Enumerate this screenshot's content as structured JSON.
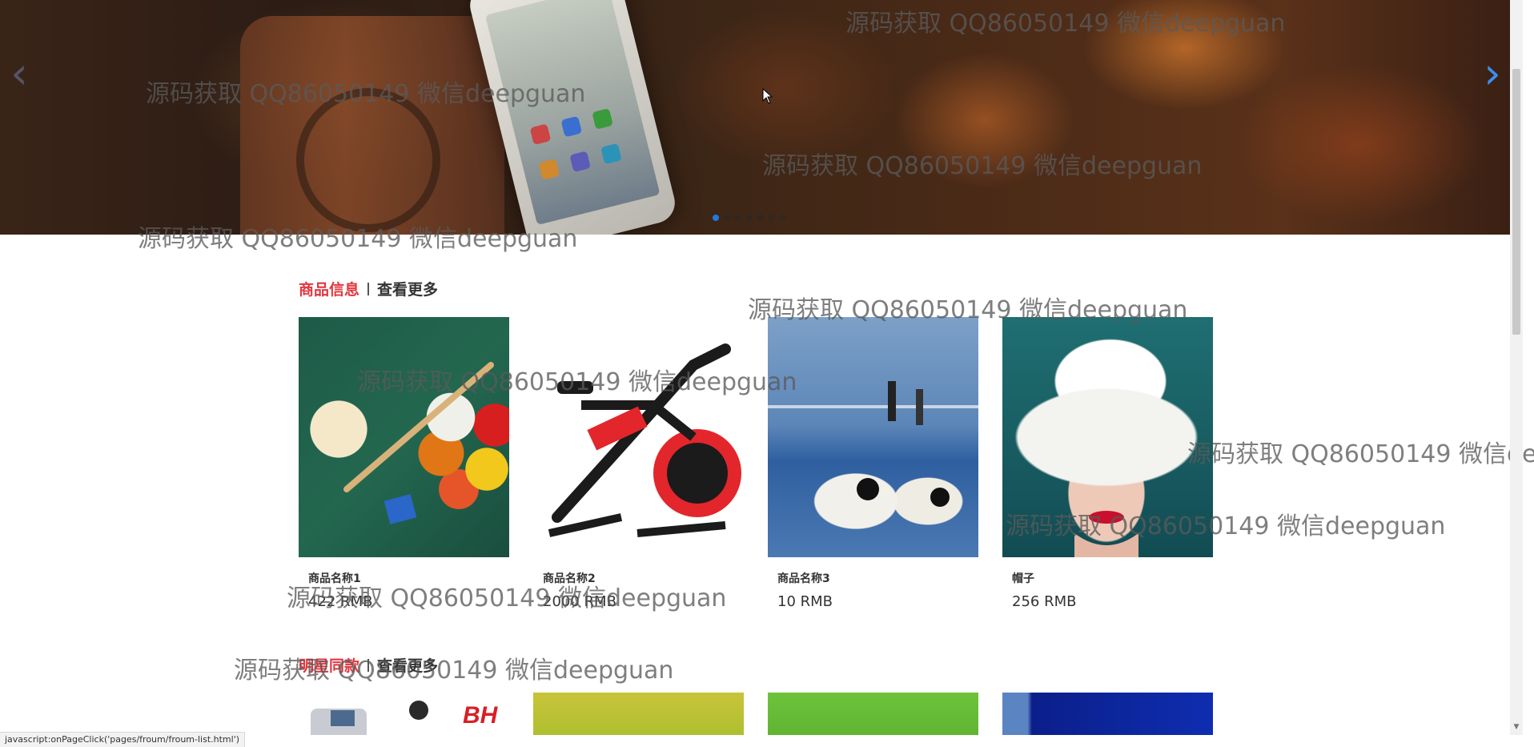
{
  "banner": {
    "prev_label": "‹",
    "next_label": "›",
    "dots_count": 7,
    "active_dot": 0
  },
  "section1": {
    "title": "商品信息",
    "more": "查看更多",
    "items": [
      {
        "name": "商品名称1",
        "price": "422 RMB",
        "image": "billiards"
      },
      {
        "name": "商品名称2",
        "price": "2000 RMB",
        "image": "exercise-bike"
      },
      {
        "name": "商品名称3",
        "price": "10 RMB",
        "image": "badminton-shuttlecock"
      },
      {
        "name": "帽子",
        "price": "256 RMB",
        "image": "white-hat"
      }
    ]
  },
  "section2": {
    "title": "明星同款",
    "more": "查看更多"
  },
  "watermark": "源码获取 QQ86050149 微信deepguan",
  "statusbar": "javascript:onPageClick('pages/froum/froum-list.html')",
  "colors": {
    "accent_red": "#e2373f",
    "arrow_blue": "#3a8ef0",
    "dot_active": "#1f7ae0"
  }
}
